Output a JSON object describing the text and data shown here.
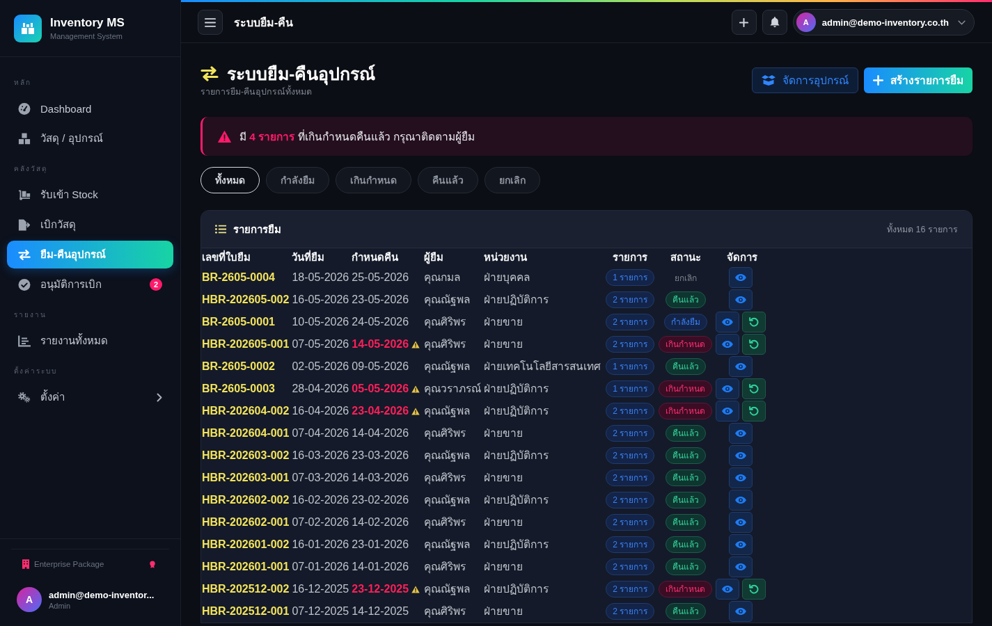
{
  "sidebar": {
    "brand": {
      "name": "Inventory MS",
      "tagline": "Management System"
    },
    "sections": [
      {
        "title": "หลัก",
        "items": [
          {
            "label": "Dashboard",
            "selected": false
          },
          {
            "label": "วัสดุ / อุปกรณ์",
            "selected": false
          }
        ]
      },
      {
        "title": "คลังวัสดุ",
        "items": [
          {
            "label": "รับเข้า Stock",
            "selected": false
          },
          {
            "label": "เบิกวัสดุ",
            "selected": false
          },
          {
            "label": "ยืม-คืนอุปกรณ์",
            "selected": true
          },
          {
            "label": "อนุมัติการเบิก",
            "selected": false,
            "badge": "2"
          }
        ]
      },
      {
        "title": "รายงาน",
        "items": [
          {
            "label": "รายงานทั้งหมด",
            "selected": false
          }
        ]
      },
      {
        "title": "ตั้งค่าระบบ",
        "items": [
          {
            "label": "ตั้งค่า",
            "selected": false,
            "submenu": {
              "expanded": false
            }
          }
        ]
      }
    ],
    "package": {
      "label": "Enterprise Package"
    },
    "user": {
      "initial": "A",
      "email": "admin@demo-inventor...",
      "role": "Admin"
    }
  },
  "header": {
    "title": "ระบบยืม-คืน",
    "user": {
      "initial": "A",
      "email": "admin@demo-inventory.co.th"
    }
  },
  "page": {
    "title": "ระบบยืม-คืนอุปกรณ์",
    "subtitle": "รายการยืม-คืนอุปกรณ์ทั้งหมด",
    "actions": [
      {
        "label": "จัดการอุปกรณ์",
        "kind": "outline"
      },
      {
        "label": "สร้างรายการยืม",
        "kind": "primary"
      }
    ]
  },
  "alert": {
    "text": "มี **4 รายการ** ที่เกินกำหนดคืนแล้ว กรุณาติดตามผู้ยืม"
  },
  "filters": [
    {
      "label": "ทั้งหมด",
      "selected": true
    },
    {
      "label": "กำลังยืม",
      "selected": false
    },
    {
      "label": "เกินกำหนด",
      "selected": false
    },
    {
      "label": "คืนแล้ว",
      "selected": false
    },
    {
      "label": "ยกเลิก",
      "selected": false
    }
  ],
  "table": {
    "title": "รายการยืม",
    "total": "ทั้งหมด 16 รายการ",
    "columns": [
      "เลขที่ใบยืม",
      "วันที่ยืม",
      "กำหนดคืน",
      "ผู้ยืม",
      "หน่วยงาน",
      "รายการ",
      "สถานะ",
      "จัดการ"
    ],
    "rows": [
      {
        "id": "BR-2605-0004",
        "borrow_date": "18-05-2026",
        "due_date": "25-05-2026",
        "overdue": false,
        "borrower": "คุณกมล",
        "department": "ฝ่ายบุคคล",
        "items": "1 รายการ",
        "status": {
          "label": "ยกเลิก",
          "kind": "cancelled"
        },
        "can_return": false
      },
      {
        "id": "HBR-202605-002",
        "borrow_date": "16-05-2026",
        "due_date": "23-05-2026",
        "overdue": false,
        "borrower": "คุณณัฐพล",
        "department": "ฝ่ายปฏิบัติการ",
        "items": "2 รายการ",
        "status": {
          "label": "คืนแล้ว",
          "kind": "returned"
        },
        "can_return": false
      },
      {
        "id": "BR-2605-0001",
        "borrow_date": "10-05-2026",
        "due_date": "24-05-2026",
        "overdue": false,
        "borrower": "คุณศิริพร",
        "department": "ฝ่ายขาย",
        "items": "2 รายการ",
        "status": {
          "label": "กำลังยืม",
          "kind": "borrowing"
        },
        "can_return": true
      },
      {
        "id": "HBR-202605-001",
        "borrow_date": "07-05-2026",
        "due_date": "14-05-2026",
        "overdue": true,
        "borrower": "คุณศิริพร",
        "department": "ฝ่ายขาย",
        "items": "2 รายการ",
        "status": {
          "label": "เกินกำหนด",
          "kind": "overdue"
        },
        "can_return": true
      },
      {
        "id": "BR-2605-0002",
        "borrow_date": "02-05-2026",
        "due_date": "09-05-2026",
        "overdue": false,
        "borrower": "คุณณัฐพล",
        "department": "ฝ่ายเทคโนโลยีสารสนเทศ",
        "items": "1 รายการ",
        "status": {
          "label": "คืนแล้ว",
          "kind": "returned"
        },
        "can_return": false
      },
      {
        "id": "BR-2605-0003",
        "borrow_date": "28-04-2026",
        "due_date": "05-05-2026",
        "overdue": true,
        "borrower": "คุณวราภรณ์",
        "department": "ฝ่ายปฏิบัติการ",
        "items": "1 รายการ",
        "status": {
          "label": "เกินกำหนด",
          "kind": "overdue"
        },
        "can_return": true
      },
      {
        "id": "HBR-202604-002",
        "borrow_date": "16-04-2026",
        "due_date": "23-04-2026",
        "overdue": true,
        "borrower": "คุณณัฐพล",
        "department": "ฝ่ายปฏิบัติการ",
        "items": "2 รายการ",
        "status": {
          "label": "เกินกำหนด",
          "kind": "overdue"
        },
        "can_return": true
      },
      {
        "id": "HBR-202604-001",
        "borrow_date": "07-04-2026",
        "due_date": "14-04-2026",
        "overdue": false,
        "borrower": "คุณศิริพร",
        "department": "ฝ่ายขาย",
        "items": "2 รายการ",
        "status": {
          "label": "คืนแล้ว",
          "kind": "returned"
        },
        "can_return": false
      },
      {
        "id": "HBR-202603-002",
        "borrow_date": "16-03-2026",
        "due_date": "23-03-2026",
        "overdue": false,
        "borrower": "คุณณัฐพล",
        "department": "ฝ่ายปฏิบัติการ",
        "items": "2 รายการ",
        "status": {
          "label": "คืนแล้ว",
          "kind": "returned"
        },
        "can_return": false
      },
      {
        "id": "HBR-202603-001",
        "borrow_date": "07-03-2026",
        "due_date": "14-03-2026",
        "overdue": false,
        "borrower": "คุณศิริพร",
        "department": "ฝ่ายขาย",
        "items": "2 รายการ",
        "status": {
          "label": "คืนแล้ว",
          "kind": "returned"
        },
        "can_return": false
      },
      {
        "id": "HBR-202602-002",
        "borrow_date": "16-02-2026",
        "due_date": "23-02-2026",
        "overdue": false,
        "borrower": "คุณณัฐพล",
        "department": "ฝ่ายปฏิบัติการ",
        "items": "2 รายการ",
        "status": {
          "label": "คืนแล้ว",
          "kind": "returned"
        },
        "can_return": false
      },
      {
        "id": "HBR-202602-001",
        "borrow_date": "07-02-2026",
        "due_date": "14-02-2026",
        "overdue": false,
        "borrower": "คุณศิริพร",
        "department": "ฝ่ายขาย",
        "items": "2 รายการ",
        "status": {
          "label": "คืนแล้ว",
          "kind": "returned"
        },
        "can_return": false
      },
      {
        "id": "HBR-202601-002",
        "borrow_date": "16-01-2026",
        "due_date": "23-01-2026",
        "overdue": false,
        "borrower": "คุณณัฐพล",
        "department": "ฝ่ายปฏิบัติการ",
        "items": "2 รายการ",
        "status": {
          "label": "คืนแล้ว",
          "kind": "returned"
        },
        "can_return": false
      },
      {
        "id": "HBR-202601-001",
        "borrow_date": "07-01-2026",
        "due_date": "14-01-2026",
        "overdue": false,
        "borrower": "คุณศิริพร",
        "department": "ฝ่ายขาย",
        "items": "2 รายการ",
        "status": {
          "label": "คืนแล้ว",
          "kind": "returned"
        },
        "can_return": false
      },
      {
        "id": "HBR-202512-002",
        "borrow_date": "16-12-2025",
        "due_date": "23-12-2025",
        "overdue": true,
        "borrower": "คุณณัฐพล",
        "department": "ฝ่ายปฏิบัติการ",
        "items": "2 รายการ",
        "status": {
          "label": "เกินกำหนด",
          "kind": "overdue"
        },
        "can_return": true
      },
      {
        "id": "HBR-202512-001",
        "borrow_date": "07-12-2025",
        "due_date": "14-12-2025",
        "overdue": false,
        "borrower": "คุณศิริพร",
        "department": "ฝ่ายขาย",
        "items": "2 รายการ",
        "status": {
          "label": "คืนแล้ว",
          "kind": "returned"
        },
        "can_return": false
      }
    ]
  }
}
